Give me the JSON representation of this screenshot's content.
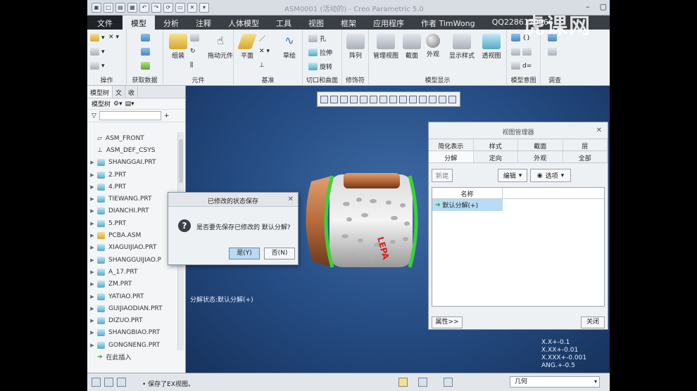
{
  "window": {
    "title": "ASM0001 (活动的) - Creo Parametric 5.0"
  },
  "menu": {
    "tabs": [
      "文件",
      "模型",
      "分析",
      "注释",
      "人体模型",
      "工具",
      "视图",
      "框架",
      "应用程序",
      "作者 TimWong",
      "QQ2286170966"
    ],
    "active": "模型"
  },
  "ribbon": {
    "groups": {
      "operations": "操作",
      "get_data": "获取数据",
      "component": "元件",
      "datum": "基准",
      "cut_surface": "切口和曲面",
      "modifiers": "修饰符",
      "model_display": "模型显示",
      "model_intent": "模型意图",
      "investigate": "调查"
    },
    "buttons": {
      "assemble": "组装",
      "drag_component": "拖动元件",
      "plane": "平面",
      "sketch": "草绘",
      "hole": "孔",
      "extrude": "拉伸",
      "revolve": "旋转",
      "pattern": "阵列",
      "manage_views": "管理视图",
      "section": "截面",
      "appearance": "外观",
      "display_style": "显示样式",
      "perspective": "透视图",
      "d_eq": "d="
    }
  },
  "model_tree": {
    "tabs": [
      "模型树",
      "文",
      "收"
    ],
    "header": "模型树",
    "items": [
      {
        "label": "ASM_FRONT",
        "type": "plane",
        "expandable": false
      },
      {
        "label": "ASM_DEF_CSYS",
        "type": "csys",
        "expandable": false
      },
      {
        "label": "SHANGGAI.PRT",
        "type": "part",
        "expandable": true
      },
      {
        "label": "2.PRT",
        "type": "part",
        "expandable": true
      },
      {
        "label": "4.PRT",
        "type": "part",
        "expandable": true
      },
      {
        "label": "TIEWANG.PRT",
        "type": "part",
        "expandable": true
      },
      {
        "label": "DIANCHI.PRT",
        "type": "part",
        "expandable": true
      },
      {
        "label": "5.PRT",
        "type": "part",
        "expandable": true
      },
      {
        "label": "PCBA.ASM",
        "type": "asm",
        "expandable": true
      },
      {
        "label": "XIAGUIJIAO.PRT",
        "type": "part",
        "expandable": true
      },
      {
        "label": "SHANGGUIJIAO.P",
        "type": "part",
        "expandable": true
      },
      {
        "label": "A_17.PRT",
        "type": "part",
        "expandable": true
      },
      {
        "label": "ZM.PRT",
        "type": "part",
        "expandable": true
      },
      {
        "label": "YATIAO.PRT",
        "type": "part",
        "expandable": true
      },
      {
        "label": "GUIJIAODIAN.PRT",
        "type": "part",
        "expandable": true
      },
      {
        "label": "DIZUO.PRT",
        "type": "part",
        "expandable": true
      },
      {
        "label": "SHANGBIAO.PRT",
        "type": "part",
        "expandable": true
      },
      {
        "label": "GONGNENG.PRT",
        "type": "part",
        "expandable": true
      },
      {
        "label": "在此插入",
        "type": "insert",
        "expandable": false
      }
    ]
  },
  "dialog": {
    "title": "已修改的状态保存",
    "message": "是否要先保存已修改的 默认分解?",
    "yes": "是(Y)",
    "no": "否(N)"
  },
  "view_manager": {
    "title": "视图管理器",
    "tabs_row1": [
      "简化表示",
      "样式",
      "截面",
      "层"
    ],
    "tabs_row2": [
      "分解",
      "定向",
      "外观",
      "全部"
    ],
    "active_tab": "分解",
    "new_btn": "新建",
    "edit_btn": "编辑",
    "options_btn": "选项",
    "column": "名称",
    "rows": [
      "默认分解(+)"
    ],
    "properties_btn": "属性>>",
    "close_btn": "关闭"
  },
  "viewport": {
    "message": "分解状态:默认分解(+)",
    "tolerances": [
      "X.X+-0.1",
      "X.XX+-0.01",
      "X.XXX+-0.001",
      "ANG.+-0.5"
    ]
  },
  "status_bar": {
    "message": "• 保存了EX视图。",
    "filter": "几何"
  },
  "watermark": "虎课网",
  "model_text": "LEPA"
}
